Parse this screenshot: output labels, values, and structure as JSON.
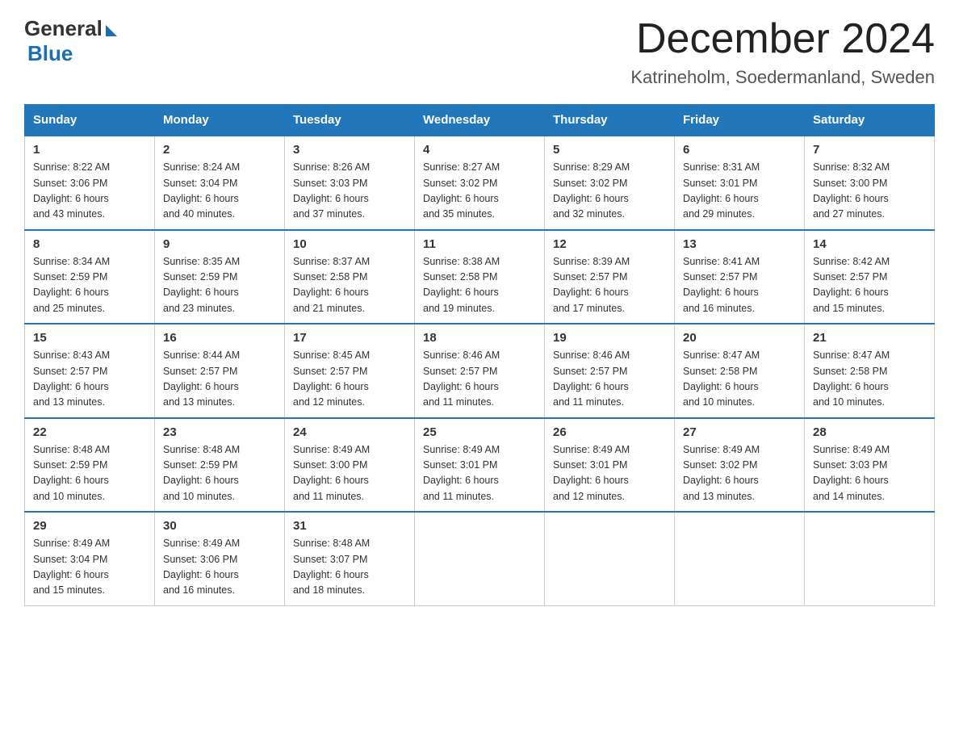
{
  "header": {
    "logo_general": "General",
    "logo_blue": "Blue",
    "month_year": "December 2024",
    "location": "Katrineholm, Soedermanland, Sweden"
  },
  "weekdays": [
    "Sunday",
    "Monday",
    "Tuesday",
    "Wednesday",
    "Thursday",
    "Friday",
    "Saturday"
  ],
  "weeks": [
    [
      {
        "day": "1",
        "info": "Sunrise: 8:22 AM\nSunset: 3:06 PM\nDaylight: 6 hours\nand 43 minutes."
      },
      {
        "day": "2",
        "info": "Sunrise: 8:24 AM\nSunset: 3:04 PM\nDaylight: 6 hours\nand 40 minutes."
      },
      {
        "day": "3",
        "info": "Sunrise: 8:26 AM\nSunset: 3:03 PM\nDaylight: 6 hours\nand 37 minutes."
      },
      {
        "day": "4",
        "info": "Sunrise: 8:27 AM\nSunset: 3:02 PM\nDaylight: 6 hours\nand 35 minutes."
      },
      {
        "day": "5",
        "info": "Sunrise: 8:29 AM\nSunset: 3:02 PM\nDaylight: 6 hours\nand 32 minutes."
      },
      {
        "day": "6",
        "info": "Sunrise: 8:31 AM\nSunset: 3:01 PM\nDaylight: 6 hours\nand 29 minutes."
      },
      {
        "day": "7",
        "info": "Sunrise: 8:32 AM\nSunset: 3:00 PM\nDaylight: 6 hours\nand 27 minutes."
      }
    ],
    [
      {
        "day": "8",
        "info": "Sunrise: 8:34 AM\nSunset: 2:59 PM\nDaylight: 6 hours\nand 25 minutes."
      },
      {
        "day": "9",
        "info": "Sunrise: 8:35 AM\nSunset: 2:59 PM\nDaylight: 6 hours\nand 23 minutes."
      },
      {
        "day": "10",
        "info": "Sunrise: 8:37 AM\nSunset: 2:58 PM\nDaylight: 6 hours\nand 21 minutes."
      },
      {
        "day": "11",
        "info": "Sunrise: 8:38 AM\nSunset: 2:58 PM\nDaylight: 6 hours\nand 19 minutes."
      },
      {
        "day": "12",
        "info": "Sunrise: 8:39 AM\nSunset: 2:57 PM\nDaylight: 6 hours\nand 17 minutes."
      },
      {
        "day": "13",
        "info": "Sunrise: 8:41 AM\nSunset: 2:57 PM\nDaylight: 6 hours\nand 16 minutes."
      },
      {
        "day": "14",
        "info": "Sunrise: 8:42 AM\nSunset: 2:57 PM\nDaylight: 6 hours\nand 15 minutes."
      }
    ],
    [
      {
        "day": "15",
        "info": "Sunrise: 8:43 AM\nSunset: 2:57 PM\nDaylight: 6 hours\nand 13 minutes."
      },
      {
        "day": "16",
        "info": "Sunrise: 8:44 AM\nSunset: 2:57 PM\nDaylight: 6 hours\nand 13 minutes."
      },
      {
        "day": "17",
        "info": "Sunrise: 8:45 AM\nSunset: 2:57 PM\nDaylight: 6 hours\nand 12 minutes."
      },
      {
        "day": "18",
        "info": "Sunrise: 8:46 AM\nSunset: 2:57 PM\nDaylight: 6 hours\nand 11 minutes."
      },
      {
        "day": "19",
        "info": "Sunrise: 8:46 AM\nSunset: 2:57 PM\nDaylight: 6 hours\nand 11 minutes."
      },
      {
        "day": "20",
        "info": "Sunrise: 8:47 AM\nSunset: 2:58 PM\nDaylight: 6 hours\nand 10 minutes."
      },
      {
        "day": "21",
        "info": "Sunrise: 8:47 AM\nSunset: 2:58 PM\nDaylight: 6 hours\nand 10 minutes."
      }
    ],
    [
      {
        "day": "22",
        "info": "Sunrise: 8:48 AM\nSunset: 2:59 PM\nDaylight: 6 hours\nand 10 minutes."
      },
      {
        "day": "23",
        "info": "Sunrise: 8:48 AM\nSunset: 2:59 PM\nDaylight: 6 hours\nand 10 minutes."
      },
      {
        "day": "24",
        "info": "Sunrise: 8:49 AM\nSunset: 3:00 PM\nDaylight: 6 hours\nand 11 minutes."
      },
      {
        "day": "25",
        "info": "Sunrise: 8:49 AM\nSunset: 3:01 PM\nDaylight: 6 hours\nand 11 minutes."
      },
      {
        "day": "26",
        "info": "Sunrise: 8:49 AM\nSunset: 3:01 PM\nDaylight: 6 hours\nand 12 minutes."
      },
      {
        "day": "27",
        "info": "Sunrise: 8:49 AM\nSunset: 3:02 PM\nDaylight: 6 hours\nand 13 minutes."
      },
      {
        "day": "28",
        "info": "Sunrise: 8:49 AM\nSunset: 3:03 PM\nDaylight: 6 hours\nand 14 minutes."
      }
    ],
    [
      {
        "day": "29",
        "info": "Sunrise: 8:49 AM\nSunset: 3:04 PM\nDaylight: 6 hours\nand 15 minutes."
      },
      {
        "day": "30",
        "info": "Sunrise: 8:49 AM\nSunset: 3:06 PM\nDaylight: 6 hours\nand 16 minutes."
      },
      {
        "day": "31",
        "info": "Sunrise: 8:48 AM\nSunset: 3:07 PM\nDaylight: 6 hours\nand 18 minutes."
      },
      null,
      null,
      null,
      null
    ]
  ]
}
